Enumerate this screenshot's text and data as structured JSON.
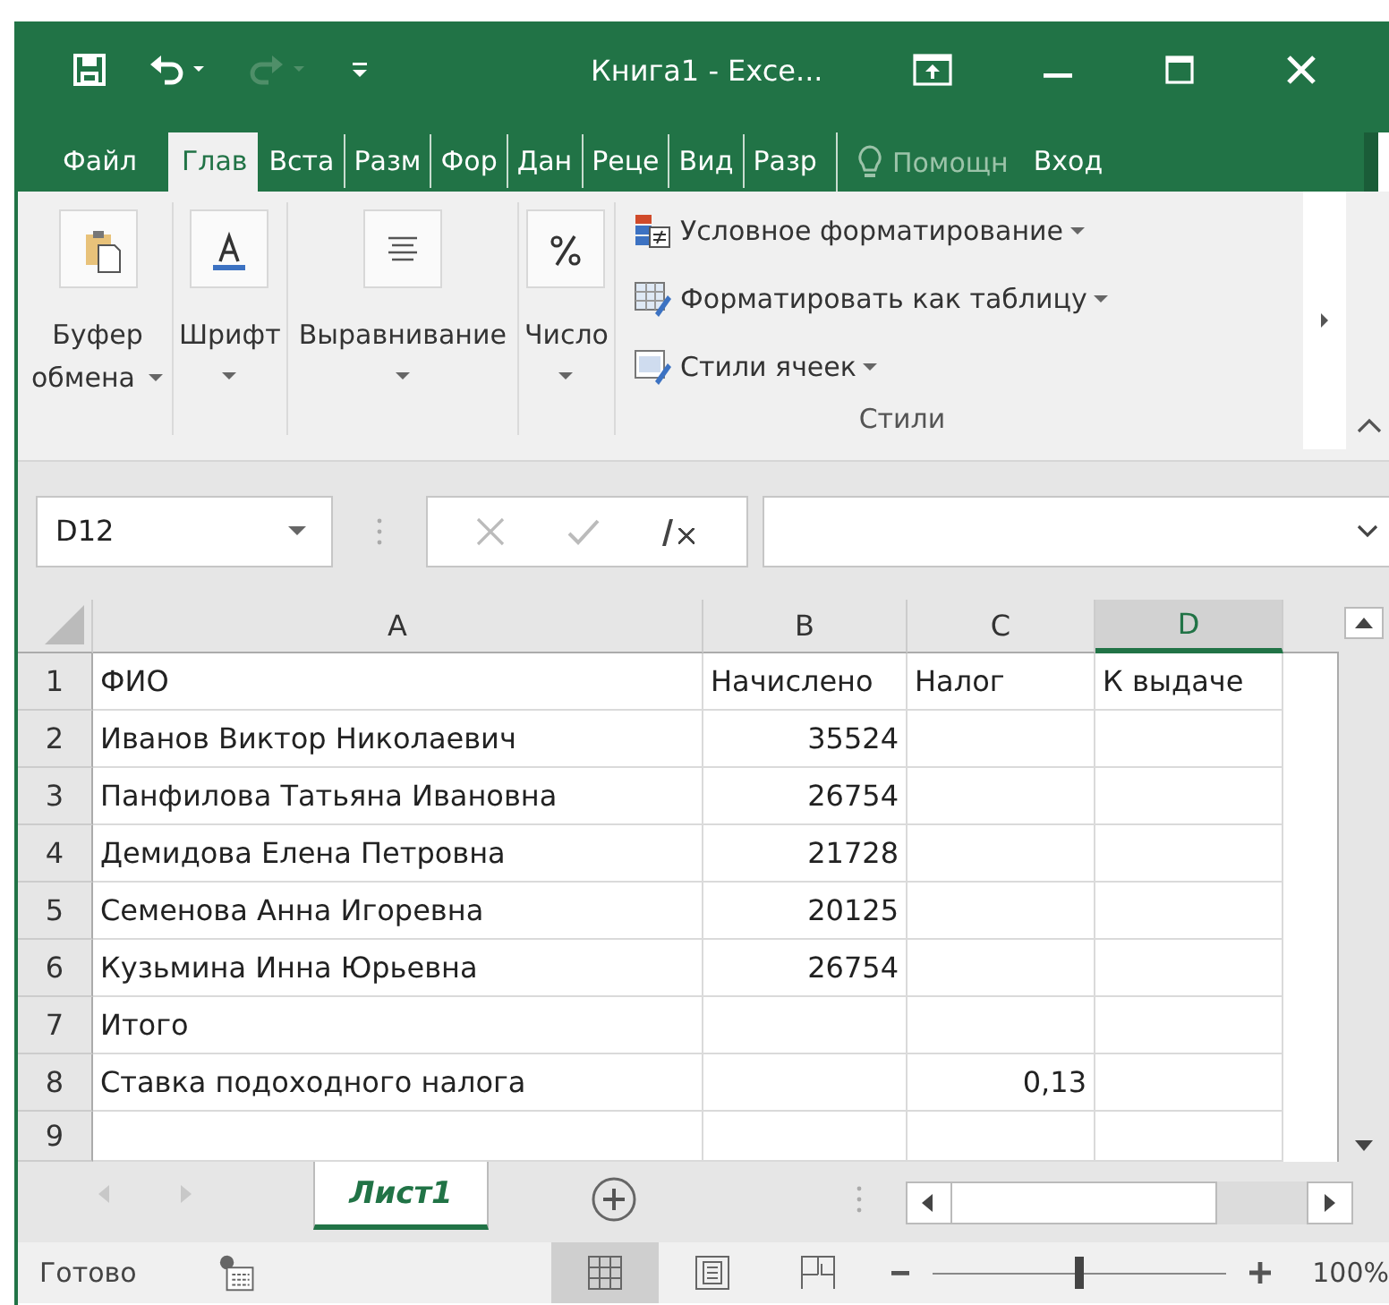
{
  "window": {
    "title": "Книга1 - Exce..."
  },
  "quick_access": {
    "redo_disabled": true
  },
  "ribbon_tabs": [
    {
      "label": "Файл",
      "selected": false
    },
    {
      "label": "Глав",
      "selected": true
    },
    {
      "label": "Вста",
      "selected": false
    },
    {
      "label": "Разм",
      "selected": false
    },
    {
      "label": "Фор",
      "selected": false
    },
    {
      "label": "Дан",
      "selected": false
    },
    {
      "label": "Реце",
      "selected": false
    },
    {
      "label": "Вид",
      "selected": false
    },
    {
      "label": "Разр",
      "selected": false
    }
  ],
  "tell_me": {
    "placeholder": "Помощн"
  },
  "sign_in": "Вход",
  "ribbon_groups": [
    {
      "kind": "clipboard",
      "label": "Буфер",
      "label_2": "обмена"
    },
    {
      "kind": "font",
      "label": "Шрифт"
    },
    {
      "kind": "alignment",
      "label": "Выравнивание"
    },
    {
      "kind": "number",
      "label": "Число"
    }
  ],
  "styles_group": {
    "label": "Стили",
    "commands": [
      {
        "kind": "conditional",
        "label": "Условное форматирование"
      },
      {
        "kind": "table",
        "label": "Форматировать как таблицу"
      },
      {
        "kind": "cellstyles",
        "label": "Стили ячеек"
      }
    ]
  },
  "name_box": {
    "value": "D12"
  },
  "columns": [
    {
      "label": "A",
      "selected": false
    },
    {
      "label": "B",
      "selected": false
    },
    {
      "label": "C",
      "selected": false
    },
    {
      "label": "D",
      "selected": true
    }
  ],
  "rows": [
    {
      "number": "1",
      "cells": [
        {
          "kind": "text",
          "text": "ФИО"
        },
        {
          "kind": "text",
          "text": "Начислено"
        },
        {
          "kind": "text",
          "text": "Налог"
        },
        {
          "kind": "text",
          "text": "К выдаче"
        }
      ]
    },
    {
      "number": "2",
      "cells": [
        {
          "kind": "text",
          "text": "Иванов Виктор Николаевич"
        },
        {
          "kind": "number",
          "text": "35524"
        },
        {
          "kind": "empty"
        },
        {
          "kind": "empty"
        }
      ]
    },
    {
      "number": "3",
      "cells": [
        {
          "kind": "text",
          "text": "Панфилова Татьяна Ивановна"
        },
        {
          "kind": "number",
          "text": "26754"
        },
        {
          "kind": "empty"
        },
        {
          "kind": "empty"
        }
      ]
    },
    {
      "number": "4",
      "cells": [
        {
          "kind": "text",
          "text": "Демидова Елена Петровна"
        },
        {
          "kind": "number",
          "text": "21728"
        },
        {
          "kind": "empty"
        },
        {
          "kind": "empty"
        }
      ]
    },
    {
      "number": "5",
      "cells": [
        {
          "kind": "text",
          "text": "Семенова Анна Игоревна"
        },
        {
          "kind": "number",
          "text": "20125"
        },
        {
          "kind": "empty"
        },
        {
          "kind": "empty"
        }
      ]
    },
    {
      "number": "6",
      "cells": [
        {
          "kind": "text",
          "text": "Кузьмина Инна Юрьевна"
        },
        {
          "kind": "number",
          "text": "26754"
        },
        {
          "kind": "empty"
        },
        {
          "kind": "empty"
        }
      ]
    },
    {
      "number": "7",
      "cells": [
        {
          "kind": "text",
          "text": "Итого"
        },
        {
          "kind": "empty"
        },
        {
          "kind": "empty"
        },
        {
          "kind": "empty"
        }
      ]
    },
    {
      "number": "8",
      "cells": [
        {
          "kind": "text",
          "text": "Ставка подоходного налога"
        },
        {
          "kind": "empty"
        },
        {
          "kind": "number",
          "text": "0,13"
        },
        {
          "kind": "empty"
        }
      ]
    },
    {
      "number": "9",
      "cells": [
        {
          "kind": "empty"
        },
        {
          "kind": "empty"
        },
        {
          "kind": "empty"
        },
        {
          "kind": "empty"
        }
      ]
    }
  ],
  "sheet_tabs": [
    {
      "label": "Лист1",
      "selected": true
    }
  ],
  "status_bar": {
    "status": "Готово",
    "views": [
      {
        "kind": "normal",
        "selected": true
      },
      {
        "kind": "layout",
        "selected": false
      },
      {
        "kind": "pagebreak",
        "selected": false
      }
    ],
    "zoom": {
      "level": 0.5,
      "reading": "100%"
    }
  }
}
